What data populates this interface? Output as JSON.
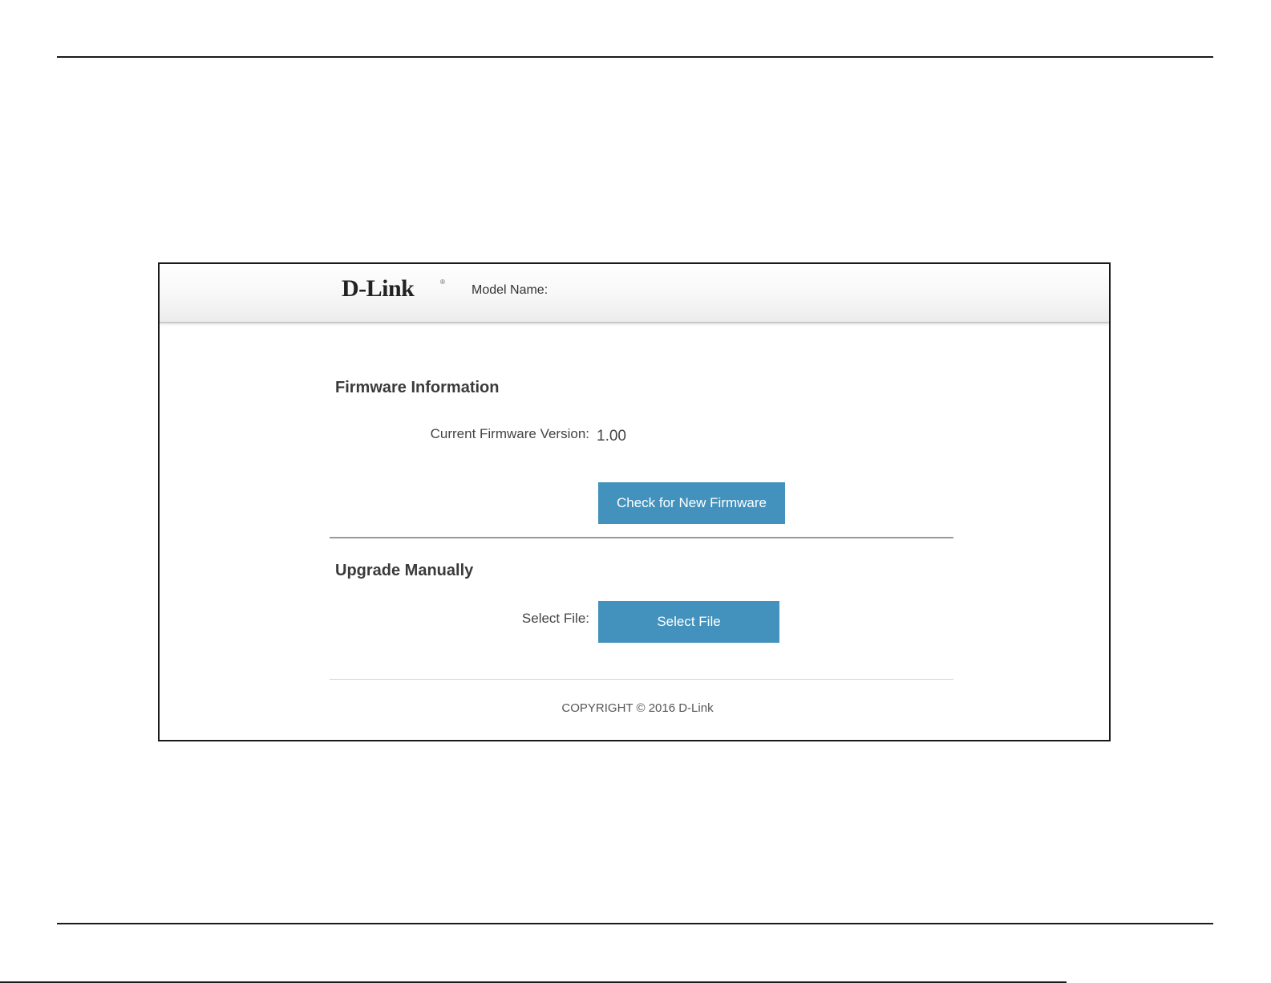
{
  "header": {
    "logo_text": "D-Link",
    "logo_mark": "®",
    "model_label": "Model Name:"
  },
  "firmware_info": {
    "title": "Firmware Information",
    "version_label": "Current Firmware Version:",
    "version_value": "1.00",
    "check_button_label": "Check for New Firmware"
  },
  "upgrade_manual": {
    "title": "Upgrade Manually",
    "file_label": "Select File:",
    "select_button_label": "Select File"
  },
  "footer": {
    "copyright": "COPYRIGHT © 2016 D-Link"
  },
  "colors": {
    "button_blue": "#4392bd",
    "heading_gray": "#3a3a3a"
  }
}
